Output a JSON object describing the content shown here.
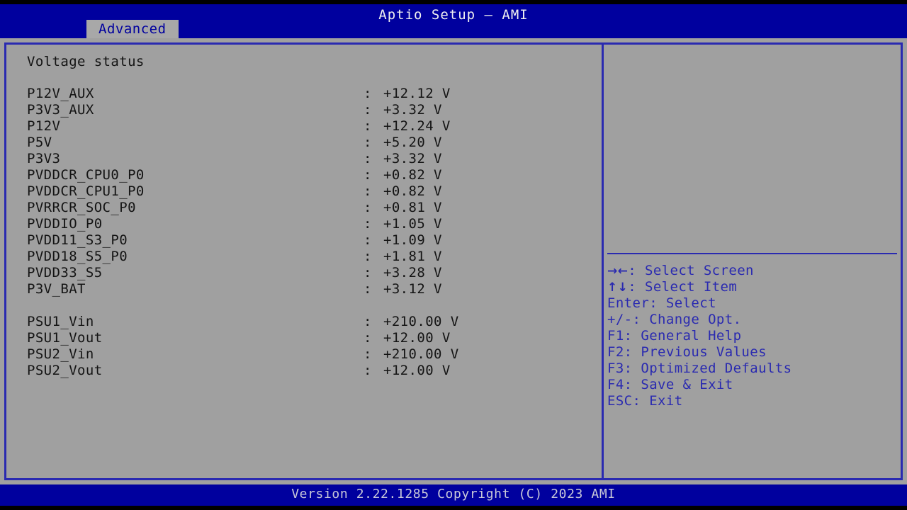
{
  "header": {
    "title": "Aptio Setup – AMI",
    "tabs": [
      {
        "label": "Advanced",
        "active": true
      }
    ]
  },
  "colors": {
    "header_blue": "#00009e",
    "panel_grey": "#a0a0a0",
    "border_blue": "#2a2ab0",
    "text_dark": "#141414",
    "help_text": "#2a2ab0",
    "tab_active_bg": "#a8a8a8",
    "footer_text": "#c8c8d8"
  },
  "main": {
    "section_title": "Voltage status",
    "separator": ":",
    "rows": [
      {
        "label": "P12V_AUX",
        "value": "+12.12 V"
      },
      {
        "label": "P3V3_AUX",
        "value": "+3.32 V"
      },
      {
        "label": "P12V",
        "value": "+12.24 V"
      },
      {
        "label": "P5V",
        "value": "+5.20 V"
      },
      {
        "label": "P3V3",
        "value": "+3.32 V"
      },
      {
        "label": "PVDDCR_CPU0_P0",
        "value": "+0.82 V"
      },
      {
        "label": "PVDDCR_CPU1_P0",
        "value": "+0.82 V"
      },
      {
        "label": "PVRRCR_SOC_P0",
        "value": "+0.81 V"
      },
      {
        "label": "PVDDIO_P0",
        "value": "+1.05 V"
      },
      {
        "label": "PVDD11_S3_P0",
        "value": "+1.09 V"
      },
      {
        "label": "PVDD18_S5_P0",
        "value": "+1.81 V"
      },
      {
        "label": "PVDD33_S5",
        "value": "+3.28 V"
      },
      {
        "label": "P3V_BAT",
        "value": "+3.12 V"
      },
      {
        "spacer": true
      },
      {
        "label": "PSU1_Vin",
        "value": "+210.00 V"
      },
      {
        "label": "PSU1_Vout",
        "value": "+12.00 V"
      },
      {
        "label": "PSU2_Vin",
        "value": "+210.00 V"
      },
      {
        "label": "PSU2_Vout",
        "value": "+12.00 V"
      }
    ]
  },
  "help": {
    "lines": [
      {
        "keys": "→←",
        "text": ": Select Screen"
      },
      {
        "keys": "↑↓",
        "text": ": Select Item"
      },
      {
        "keys": "",
        "text": "Enter: Select"
      },
      {
        "keys": "",
        "text": "+/-: Change Opt."
      },
      {
        "keys": "",
        "text": "F1: General Help"
      },
      {
        "keys": "",
        "text": "F2: Previous Values"
      },
      {
        "keys": "",
        "text": "F3: Optimized Defaults"
      },
      {
        "keys": "",
        "text": "F4: Save & Exit"
      },
      {
        "keys": "",
        "text": "ESC: Exit"
      }
    ]
  },
  "footer": {
    "version_text": "Version 2.22.1285 Copyright (C) 2023 AMI"
  }
}
